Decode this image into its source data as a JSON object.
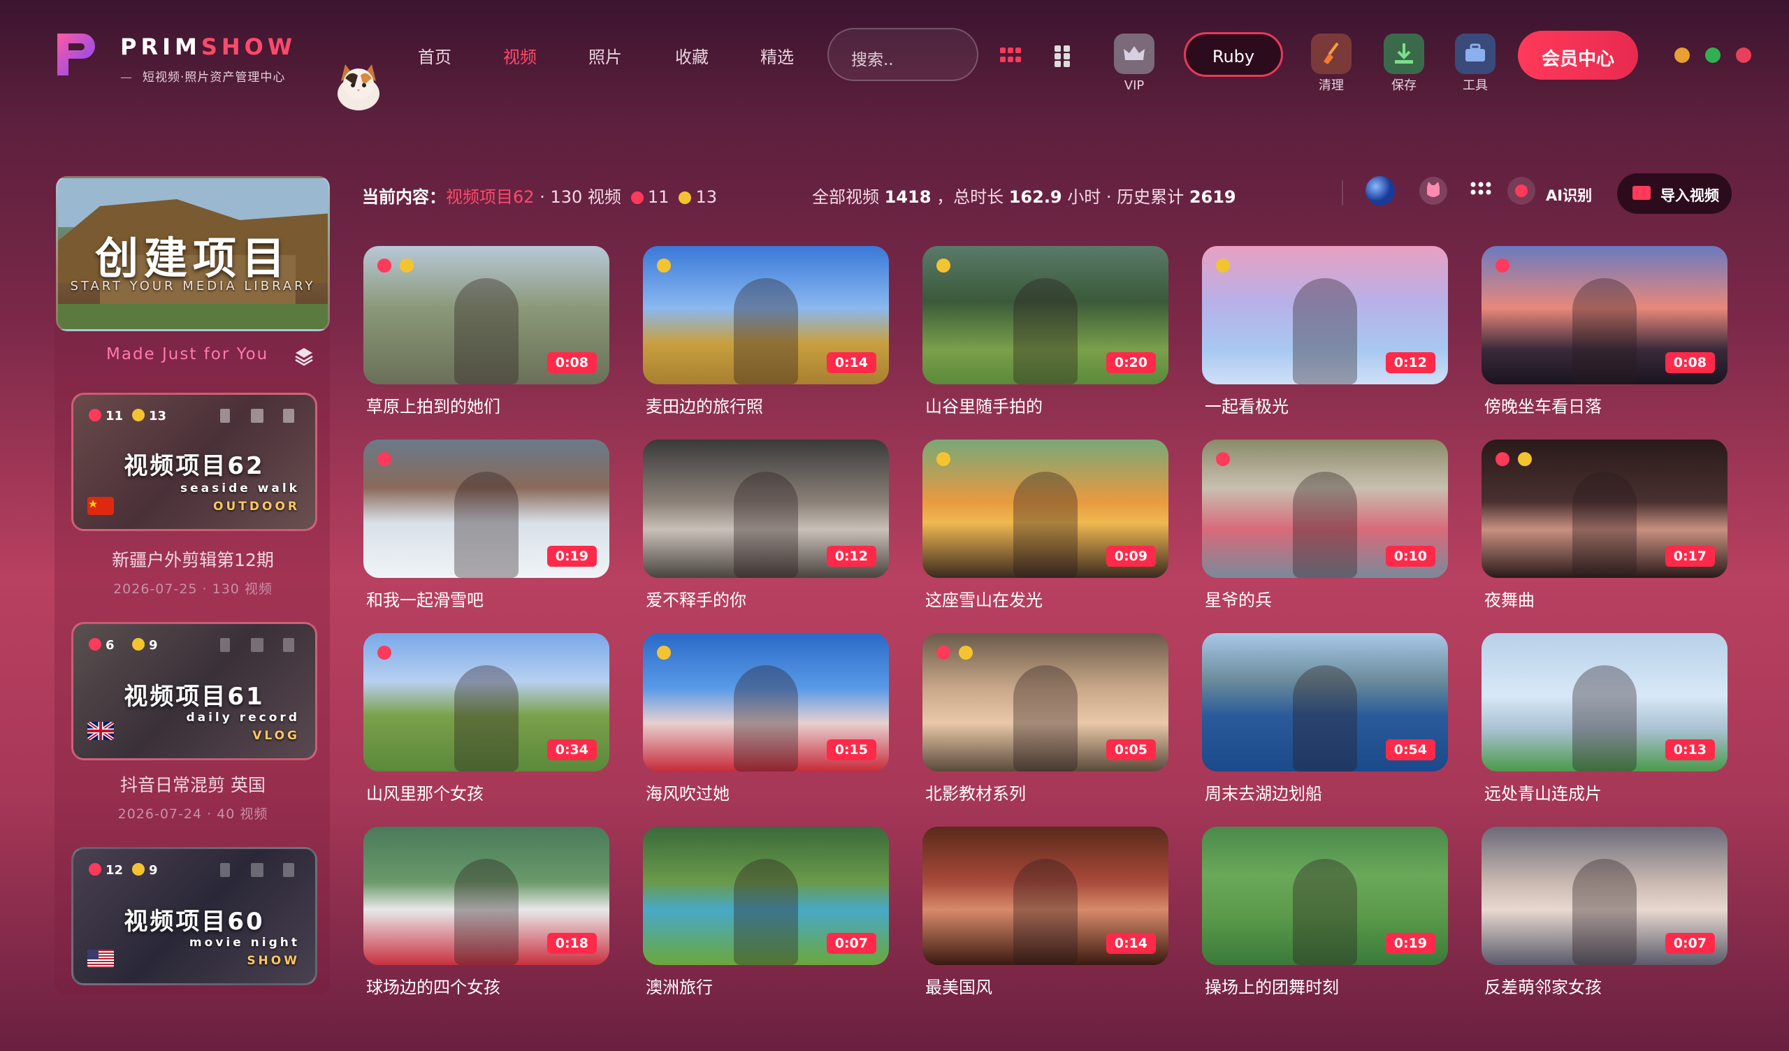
{
  "header": {
    "brand_a": "PRIM",
    "brand_b": "SHOW",
    "subtitle": "短视频·照片资产管理中心",
    "nav": [
      "首页",
      "视频",
      "照片",
      "收藏",
      "精选"
    ],
    "active_nav": "视频",
    "search_placeholder": "搜索..",
    "vip_label": "VIP",
    "user": "Ruby",
    "clean_label": "清理",
    "save_label": "保存",
    "tools_label": "工具",
    "member_center": "会员中心",
    "window_dots": [
      "#e8a030",
      "#30b050",
      "#e8405a"
    ]
  },
  "sidebar": {
    "create_title": "创建项目",
    "create_sub": "START YOUR MEDIA LIBRARY",
    "made": "Made Just for You",
    "projects": [
      {
        "title": "视频项目62",
        "s1": "seaside walk",
        "s2": "OUTDOOR",
        "red": "11",
        "yellow": "13",
        "flag": "china",
        "name": "新疆户外剪辑第12期",
        "meta": "2026-07-25 · 130 视频"
      },
      {
        "title": "视频项目61",
        "s1": "daily record",
        "s2": "VLOG",
        "red": "6",
        "yellow": "9",
        "flag": "uk",
        "name": "抖音日常混剪 英国",
        "meta": "2026-07-24 · 40 视频"
      },
      {
        "title": "视频项目60",
        "s1": "movie night",
        "s2": "SHOW",
        "red": "12",
        "yellow": "9",
        "flag": "us",
        "name": "",
        "meta": ""
      }
    ]
  },
  "toolbar": {
    "current_label": "当前内容：",
    "current_project": "视频项目62",
    "current_count": "· 130 视频",
    "red_count": "11",
    "yellow_count": "13",
    "total_label": "全部视频",
    "total_videos": "1418",
    "duration_label": "，总时长",
    "total_hours": "162.9",
    "hours_label": "小时 · 历史累计",
    "history": "2619",
    "ai_label": "AI识别",
    "import_label": "导入视频"
  },
  "videos": [
    {
      "title": "草原上拍到的她们",
      "duration": "0:08",
      "dots": [
        "red",
        "yellow"
      ]
    },
    {
      "title": "麦田边的旅行照",
      "duration": "0:14",
      "dots": [
        "yellow"
      ]
    },
    {
      "title": "山谷里随手拍的",
      "duration": "0:20",
      "dots": [
        "yellow"
      ]
    },
    {
      "title": "一起看极光",
      "duration": "0:12",
      "dots": [
        "yellow"
      ]
    },
    {
      "title": "傍晚坐车看日落",
      "duration": "0:08",
      "dots": [
        "red"
      ]
    },
    {
      "title": "和我一起滑雪吧",
      "duration": "0:19",
      "dots": [
        "red"
      ]
    },
    {
      "title": "爱不释手的你",
      "duration": "0:12",
      "dots": []
    },
    {
      "title": "这座雪山在发光",
      "duration": "0:09",
      "dots": [
        "yellow"
      ]
    },
    {
      "title": "星爷的兵",
      "duration": "0:10",
      "dots": [
        "red"
      ]
    },
    {
      "title": "夜舞曲",
      "duration": "0:17",
      "dots": [
        "red",
        "yellow"
      ]
    },
    {
      "title": "山风里那个女孩",
      "duration": "0:34",
      "dots": [
        "red"
      ]
    },
    {
      "title": "海风吹过她",
      "duration": "0:15",
      "dots": [
        "yellow"
      ]
    },
    {
      "title": "北影教材系列",
      "duration": "0:05",
      "dots": [
        "red",
        "yellow"
      ]
    },
    {
      "title": "周末去湖边划船",
      "duration": "0:54",
      "dots": []
    },
    {
      "title": "远处青山连成片",
      "duration": "0:13",
      "dots": []
    },
    {
      "title": "球场边的四个女孩",
      "duration": "0:18",
      "dots": []
    },
    {
      "title": "澳洲旅行",
      "duration": "0:07",
      "dots": []
    },
    {
      "title": "最美国风",
      "duration": "0:14",
      "dots": []
    },
    {
      "title": "操场上的团舞时刻",
      "duration": "0:19",
      "dots": []
    },
    {
      "title": "反差萌邻家女孩",
      "duration": "0:07",
      "dots": []
    }
  ],
  "colors": {
    "accent": "#ff3a5a",
    "red_dot": "#ff3a5a",
    "yellow_dot": "#f4c430"
  }
}
